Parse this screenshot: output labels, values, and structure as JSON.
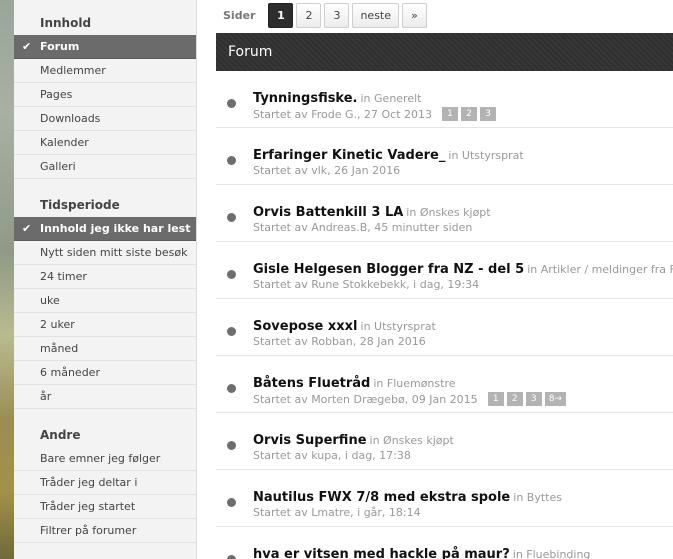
{
  "sidebar": {
    "sections": [
      {
        "title": "Innhold",
        "items": [
          {
            "label": "Forum",
            "active": true
          },
          {
            "label": "Medlemmer"
          },
          {
            "label": "Pages"
          },
          {
            "label": "Downloads"
          },
          {
            "label": "Kalender"
          },
          {
            "label": "Galleri"
          }
        ]
      },
      {
        "title": "Tidsperiode",
        "items": [
          {
            "label": "Innhold jeg ikke har lest",
            "active": true
          },
          {
            "label": "Nytt siden mitt siste besøk"
          },
          {
            "label": "24 timer"
          },
          {
            "label": "uke"
          },
          {
            "label": "2 uker"
          },
          {
            "label": "måned"
          },
          {
            "label": "6 måneder"
          },
          {
            "label": "år"
          }
        ]
      },
      {
        "title": "Andre",
        "items": [
          {
            "label": "Bare emner jeg følger"
          },
          {
            "label": "Tråder jeg deltar i"
          },
          {
            "label": "Tråder jeg startet"
          },
          {
            "label": "Filtrer på forumer"
          }
        ]
      }
    ],
    "check_glyph": "✔"
  },
  "pagination": {
    "label": "Sider",
    "pages": [
      "1",
      "2",
      "3"
    ],
    "current": "1",
    "next": "neste",
    "last": "»"
  },
  "forum": {
    "title": "Forum",
    "topics": [
      {
        "title": "Tynningsfiske.",
        "in": "in Generelt",
        "meta": "Startet av Frode G., 27 Oct 2013",
        "pages": [
          "1",
          "2",
          "3"
        ]
      },
      {
        "title": "Erfaringer Kinetic Vadere_",
        "in": "in Utstyrsprat",
        "meta": "Startet av vlk, 26 Jan 2016",
        "pages": []
      },
      {
        "title": "Orvis Battenkill 3 LA",
        "in": "in Ønskes kjøpt",
        "meta": "Startet av Andreas.B, 45 minutter siden",
        "pages": []
      },
      {
        "title": "Gisle Helgesen Blogger fra NZ - del 5",
        "in": "in Artikler / meldinger fra Fluefiske",
        "meta": "Startet av Rune Stokkebekk, i dag, 19:34",
        "pages": []
      },
      {
        "title": "Sovepose xxxl",
        "in": "in Utstyrsprat",
        "meta": "Startet av Robban, 28 Jan 2016",
        "pages": []
      },
      {
        "title": "Båtens Fluetråd",
        "in": "in Fluemønstre",
        "meta": "Startet av Morten Drægebø, 09 Jan 2015",
        "pages": [
          "1",
          "2",
          "3",
          "8→"
        ]
      },
      {
        "title": "Orvis Superfine",
        "in": "in Ønskes kjøpt",
        "meta": "Startet av kupa, i dag, 17:38",
        "pages": []
      },
      {
        "title": "Nautilus FWX 7/8 med ekstra spole",
        "in": "in Byttes",
        "meta": "Startet av Lmatre, i går, 18:14",
        "pages": []
      },
      {
        "title": "hva er vitsen med hackle på maur?",
        "in": "in Fluebinding",
        "meta": "",
        "pages": []
      }
    ]
  }
}
